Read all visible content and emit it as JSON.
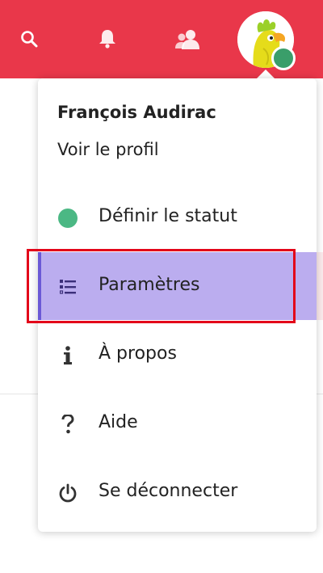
{
  "colors": {
    "header": "#e9374a",
    "active_bg": "#bbadef",
    "status_online": "#4bb884",
    "highlight": "#e3051a"
  },
  "header": {
    "icons": [
      "search-icon",
      "bell-icon",
      "contacts-icon"
    ],
    "avatar": "parrot-avatar"
  },
  "user_menu": {
    "user_name": "François Audirac",
    "view_profile": "Voir le profil",
    "items": [
      {
        "label": "Définir le statut",
        "icon": "status-online-icon"
      },
      {
        "label": "Paramètres",
        "icon": "settings-list-icon",
        "active": true
      },
      {
        "label": "À propos",
        "icon": "info-icon"
      },
      {
        "label": "Aide",
        "icon": "help-icon"
      },
      {
        "label": "Se déconnecter",
        "icon": "power-icon"
      }
    ]
  }
}
